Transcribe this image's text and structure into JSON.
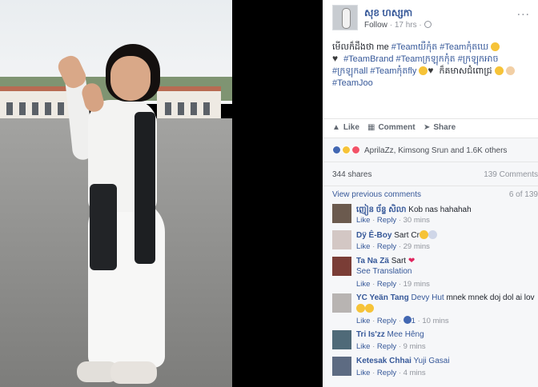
{
  "post": {
    "author": "សុខ ហស្សកា",
    "follow": "Follow",
    "time": "17 hrs",
    "sep": "·",
    "more": "...",
    "text_parts": [
      {
        "t": "មើលក៏ដឹងថា me ",
        "tag": false
      },
      {
        "t": "#Teamយឺកុំត",
        "tag": true
      },
      {
        "t": " ",
        "tag": false
      },
      {
        "t": "#Teamកុំតឃេ",
        "tag": true
      }
    ],
    "line2": [
      {
        "t": " ",
        "tag": false
      },
      {
        "t": "#TeamBrand",
        "tag": true
      },
      {
        "t": " ",
        "tag": false
      },
      {
        "t": "#Teamក្រឡុកកុំត",
        "tag": true
      },
      {
        "t": " ",
        "tag": false
      },
      {
        "t": "#ក្រឡុកអាច",
        "tag": true
      }
    ],
    "line3": [
      {
        "t": "#ក្រឡុកall",
        "tag": true
      },
      {
        "t": " ",
        "tag": false
      },
      {
        "t": "#Teamកុំតfly",
        "tag": true
      }
    ],
    "line3_end": " ក៏គមាសជំពោជ្រ ",
    "line4": "#TeamJoo"
  },
  "actions": {
    "like": "Like",
    "comment": "Comment",
    "share": "Share"
  },
  "reactions": {
    "text": "AprilaZz, Kimsong Srun and 1.6K others",
    "icons": [
      "like-reaction-icon",
      "haha-reaction-icon",
      "love-reaction-icon"
    ]
  },
  "stats": {
    "shares": "344 shares",
    "comments": "139 Comments"
  },
  "comments_section": {
    "view_previous": "View previous comments",
    "count": "6 of 139",
    "reply": "Reply",
    "like": "Like",
    "see_translation": "See Translation",
    "items": [
      {
        "name": "ញៀន ច័ន្ទ សិលា",
        "text": "Kob nas hahahah",
        "time": "30 mins",
        "avatar": "#6b5a4e"
      },
      {
        "name": "Dÿ Ê-Boy",
        "text": "Sart Cr",
        "time": "29 mins",
        "avatar": "#d3c7c4"
      },
      {
        "name": "Ta Na Zä",
        "text": "Sart",
        "time": "19 mins",
        "avatar": "#7a3d36"
      },
      {
        "name": "YC Yeän Tang",
        "text": "mnek mnek doj dol ai lov",
        "mention": "Devy Hut",
        "time": "10 mins",
        "likes": "1",
        "avatar": "#b8b4b2"
      },
      {
        "name": "Tri Is'zz",
        "text": "",
        "mention": "Mee Hêng",
        "time": "9 mins",
        "avatar": "#4f6a78"
      },
      {
        "name": "Ketesak Chhai",
        "text": "",
        "mention": "Yuji Gasai",
        "time": "4 mins",
        "avatar": "#5d6b82"
      }
    ]
  },
  "colors": {
    "link": "#365899",
    "muted": "#90949c",
    "panel_bg": "#f6f7f9"
  }
}
